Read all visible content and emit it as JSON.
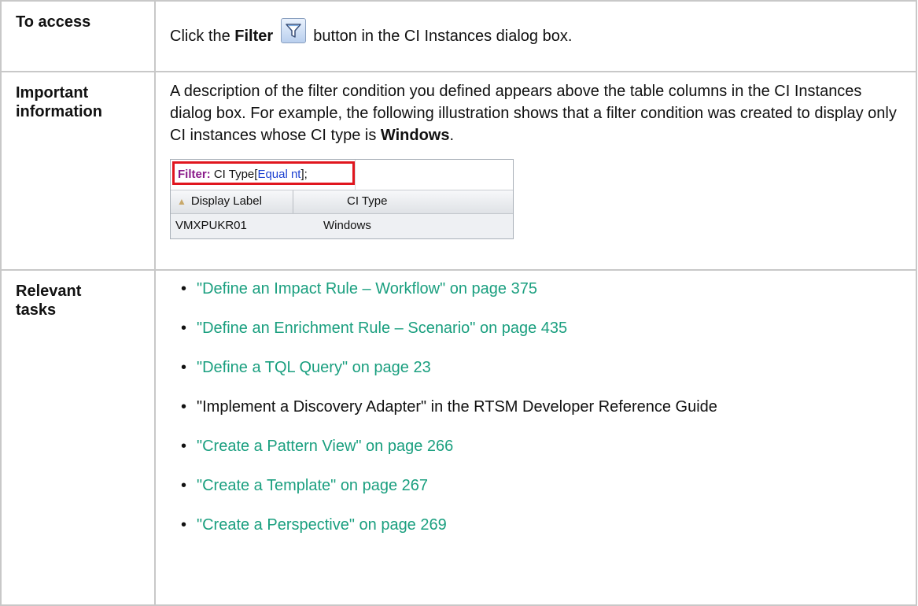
{
  "rows": {
    "access": {
      "heading": "To access",
      "text_before": "Click the ",
      "bold": "Filter",
      "text_after": " button in the CI Instances dialog box.",
      "icon": "filter-funnel-icon"
    },
    "important": {
      "heading_line1": "Important",
      "heading_line2": "information",
      "text": "A description of the filter condition you defined appears above the table columns in the CI Instances dialog box. For example, the following illustration shows that a filter condition was created to display only CI instances whose CI type is ",
      "bold": "Windows",
      "text_end": ".",
      "illustration": {
        "filter_label": "Filter:",
        "filter_text_a": " CI Type[",
        "filter_text_b": "Equal nt",
        "filter_text_c": "];",
        "col1": "Display Label",
        "col2": "CI Type",
        "cell1": "VMXPUKR01",
        "cell2": "Windows"
      }
    },
    "tasks": {
      "heading_line1": "Relevant",
      "heading_line2": "tasks",
      "items": [
        {
          "text": "\"Define an Impact Rule – Workflow\" on page 375",
          "link": true
        },
        {
          "text": "\"Define an Enrichment Rule – Scenario\" on page 435",
          "link": true
        },
        {
          "text": "\"Define a TQL Query\" on page 23",
          "link": true
        },
        {
          "text": "\"Implement a Discovery Adapter\" in the RTSM Developer Reference Guide",
          "link": false
        },
        {
          "text": "\"Create a Pattern View\" on page 266",
          "link": true
        },
        {
          "text": "\"Create a Template\" on page 267",
          "link": true
        },
        {
          "text": "\"Create a Perspective\" on page 269",
          "link": true
        }
      ]
    }
  },
  "colors": {
    "link": "#1a9f7f",
    "border": "#c8c8c8",
    "highlight": "#e0161e"
  }
}
